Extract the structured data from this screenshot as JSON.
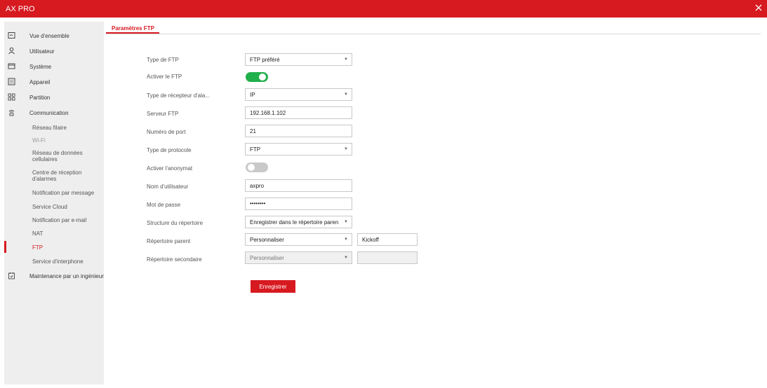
{
  "window": {
    "title": "AX PRO",
    "close_icon": "close-icon"
  },
  "colors": {
    "accent": "#d71920",
    "toggle_on": "#20b04b",
    "toggle_off": "#c9c9c9",
    "sidebar_bg": "#eeeeee"
  },
  "sidebar": {
    "items": [
      {
        "label": "Vue d'ensemble",
        "icon": "overview-icon"
      },
      {
        "label": "Utilisateur",
        "icon": "user-icon"
      },
      {
        "label": "Système",
        "icon": "system-icon"
      },
      {
        "label": "Appareil",
        "icon": "device-icon"
      },
      {
        "label": "Partition",
        "icon": "partition-icon"
      },
      {
        "label": "Communication",
        "icon": "communication-icon"
      },
      {
        "label": "Maintenance par un ingénieur",
        "icon": "maintenance-icon"
      }
    ],
    "communication_sub": [
      {
        "label": "Réseau filaire"
      },
      {
        "label": "Wi-Fi"
      },
      {
        "label": "Réseau de données cellulaires"
      },
      {
        "label": "Centre de réception d'alarmes"
      },
      {
        "label": "Notification par message"
      },
      {
        "label": "Service Cloud"
      },
      {
        "label": "Notification par e-mail"
      },
      {
        "label": "NAT"
      },
      {
        "label": "FTP"
      },
      {
        "label": "Service d'interphone"
      }
    ],
    "active": "FTP"
  },
  "tabs": [
    {
      "label": "Paramètres FTP",
      "active": true
    }
  ],
  "form": {
    "ftp_type": {
      "label": "Type de FTP",
      "value": "FTP préféré"
    },
    "enable_ftp": {
      "label": "Activer le FTP",
      "on": true
    },
    "alarm_receiver_type": {
      "label": "Type de récepteur d'ala...",
      "value": "IP"
    },
    "ftp_server": {
      "label": "Serveur FTP",
      "value": "192.168.1.102"
    },
    "port": {
      "label": "Numéro de port",
      "value": "21"
    },
    "protocol_type": {
      "label": "Type de protocole",
      "value": "FTP"
    },
    "anonymous": {
      "label": "Activer l'anonymat",
      "on": false
    },
    "username": {
      "label": "Nom d'utilisateur",
      "value": "axpro"
    },
    "password": {
      "label": "Mot de passe",
      "value": "••••••••"
    },
    "dir_structure": {
      "label": "Structure du répertoire",
      "value": "Enregistrer dans le répertoire paren"
    },
    "parent_dir": {
      "label": "Répertoire parent",
      "value": "Personnaliser",
      "custom": "Kickoff"
    },
    "secondary_dir": {
      "label": "Répertoire secondaire",
      "value": "Personnaliser",
      "custom": ""
    },
    "save_label": "Enregistrer"
  }
}
